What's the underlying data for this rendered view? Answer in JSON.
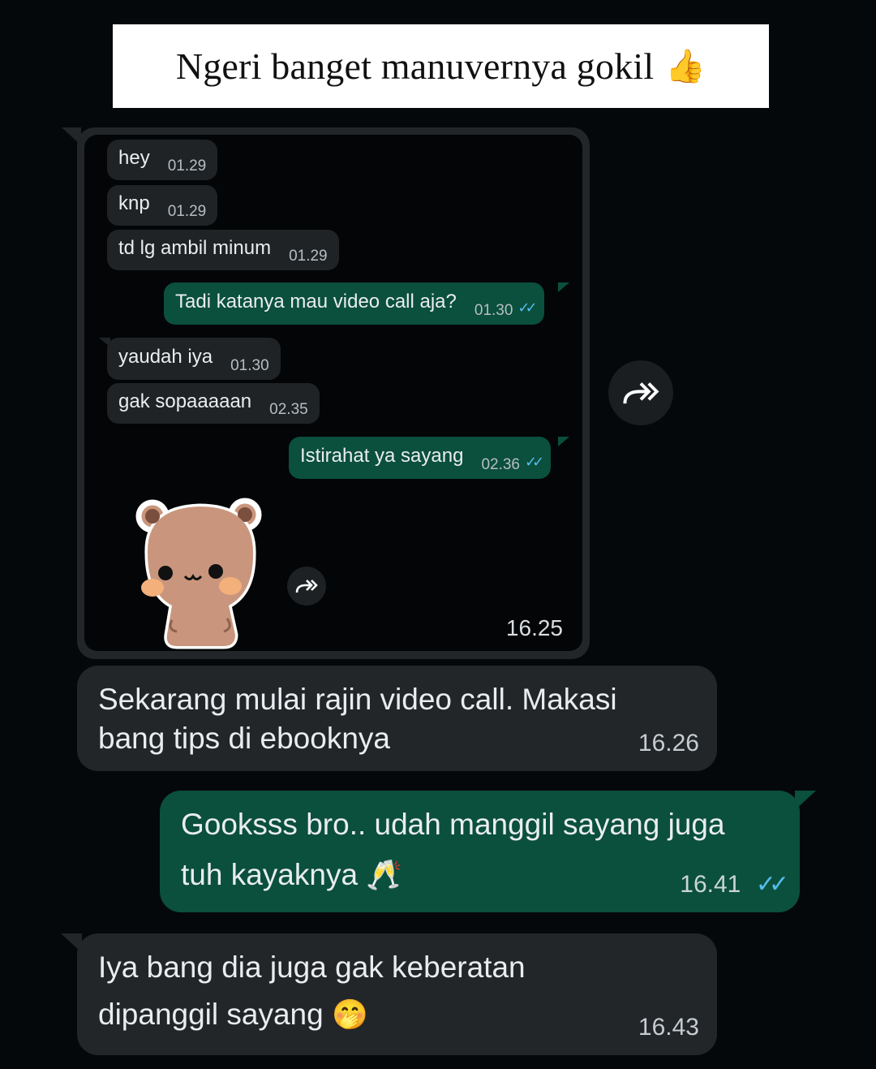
{
  "caption": {
    "text": "Ngeri banget manuvernya gokil",
    "emoji": "👍"
  },
  "forwarded_screenshot": {
    "time": "16.25",
    "messages": [
      {
        "dir": "in",
        "text": "hey",
        "time": "01.29"
      },
      {
        "dir": "in",
        "text": "knp",
        "time": "01.29"
      },
      {
        "dir": "in",
        "text": "td lg ambil minum",
        "time": "01.29"
      },
      {
        "dir": "out",
        "text": "Tadi katanya mau video call aja?",
        "time": "01.30",
        "status": "read"
      },
      {
        "dir": "in",
        "text": "yaudah iya",
        "time": "01.30"
      },
      {
        "dir": "in",
        "text": "gak sopaaaaan",
        "time": "02.35"
      },
      {
        "dir": "out",
        "text": "Istirahat ya sayang",
        "time": "02.36",
        "status": "read"
      }
    ],
    "sticker": "bear-sticker",
    "forward_icon": "forward-icon"
  },
  "messages": [
    {
      "dir": "in",
      "line1": "Sekarang mulai rajin video call. Makasi",
      "line2": "bang tips di ebooknya",
      "emoji": "",
      "time": "16.26"
    },
    {
      "dir": "out",
      "line1": "Gooksss bro.. udah manggil sayang juga",
      "line2": "tuh kayaknya",
      "emoji": "🥂",
      "time": "16.41",
      "status": "read"
    },
    {
      "dir": "in",
      "line1": "Iya bang dia juga gak keberatan",
      "line2": "dipanggil sayang",
      "emoji": "🤭",
      "time": "16.43"
    }
  ],
  "colors": {
    "background": "#05080a",
    "incoming_bubble": "#222629",
    "outgoing_bubble": "#0b4f3d",
    "read_ticks": "#53bdeb"
  },
  "icons": {
    "forward": "forward-icon",
    "read_receipt": "double-check-icon"
  }
}
